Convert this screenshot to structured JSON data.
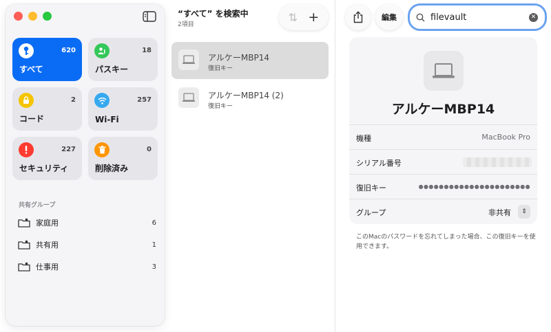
{
  "sidebar": {
    "tiles": [
      {
        "label": "すべて",
        "count": "620",
        "icon": "key-icon",
        "color": "#0a6cf5"
      },
      {
        "label": "パスキー",
        "count": "18",
        "icon": "person-key-icon",
        "color": "#34c759"
      },
      {
        "label": "コード",
        "count": "2",
        "icon": "lock-code-icon",
        "color": "#f5c400"
      },
      {
        "label": "Wi-Fi",
        "count": "257",
        "icon": "wifi-icon",
        "color": "#36a9f0"
      },
      {
        "label": "セキュリティ",
        "count": "227",
        "icon": "exclamation-icon",
        "color": "#ff3b30"
      },
      {
        "label": "削除済み",
        "count": "0",
        "icon": "trash-icon",
        "color": "#ff9500"
      }
    ],
    "group_heading": "共有グループ",
    "groups": [
      {
        "label": "家庭用",
        "count": "6"
      },
      {
        "label": "共有用",
        "count": "1"
      },
      {
        "label": "仕事用",
        "count": "3"
      }
    ]
  },
  "list": {
    "title": "“すべて” を検索中",
    "subtitle": "2項目",
    "items": [
      {
        "title": "アルケーMBP14",
        "subtitle": "復旧キー"
      },
      {
        "title": "アルケーMBP14 (2)",
        "subtitle": "復旧キー"
      }
    ]
  },
  "detail": {
    "edit_label": "編集",
    "search_value": "filevault",
    "name": "アルケーMBP14",
    "fields": {
      "model_label": "機種",
      "model_value": "MacBook Pro",
      "serial_label": "シリアル番号",
      "recovery_label": "復旧キー",
      "recovery_value": "●●●●●●●●●●●●●●●●●●●●●●",
      "group_label": "グループ",
      "group_value": "非共有"
    },
    "footnote": "このMacのパスワードを忘れてしまった場合、この復旧キーを使用できます。"
  }
}
